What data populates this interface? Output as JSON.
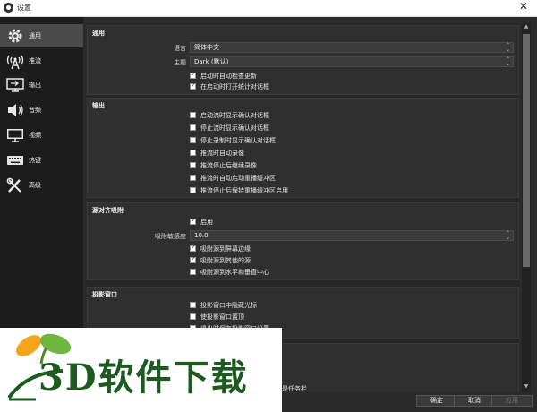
{
  "window": {
    "title": "设置",
    "close": "✕"
  },
  "sidebar": {
    "items": [
      {
        "label": "通用",
        "icon": "gear-icon"
      },
      {
        "label": "推流",
        "icon": "broadcast-icon"
      },
      {
        "label": "输出",
        "icon": "output-monitor-icon"
      },
      {
        "label": "音频",
        "icon": "speaker-icon"
      },
      {
        "label": "视频",
        "icon": "monitor-icon"
      },
      {
        "label": "热键",
        "icon": "keyboard-icon"
      },
      {
        "label": "高级",
        "icon": "tools-icon"
      }
    ]
  },
  "general": {
    "title": "通用",
    "language_label": "语言",
    "language_value": "简体中文",
    "theme_label": "主题",
    "theme_value": "Dark (默认)",
    "check_updates": "启动时自动检查更新",
    "open_stats": "在启动时打开统计对话框"
  },
  "output": {
    "title": "输出",
    "items": [
      "启动流时显示确认对话框",
      "停止流时显示确认对话框",
      "停止录制时显示确认对话框",
      "推流时自动录像",
      "推流停止后继续录像",
      "推流时自动启动重播缓冲区",
      "推流停止后保持重播缓冲区启用"
    ]
  },
  "snapping": {
    "title": "源对齐吸附",
    "enable": "启用",
    "sensitivity_label": "吸附敏感度",
    "sensitivity_value": "10.0",
    "items": [
      "吸附源到屏幕边缘",
      "吸附源到其他的源",
      "吸附源到水平和垂直中心"
    ]
  },
  "projector": {
    "title": "投影窗口",
    "items": [
      "投影窗口中隐藏光标",
      "使投影窗口置顶",
      "退出时保存投影窗口设置"
    ]
  },
  "partial_text": "是任务栏",
  "buttons": {
    "ok": "确定",
    "cancel": "取消",
    "apply": "应用"
  },
  "watermark": {
    "text": "3D软件下载"
  },
  "colors": {
    "accent": "#1c5a1f",
    "panel": "#2f2f2f",
    "sidebar": "#1c1c1c"
  }
}
